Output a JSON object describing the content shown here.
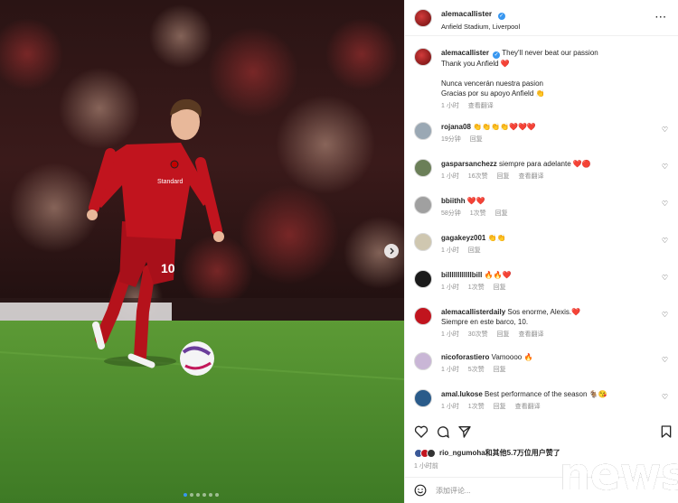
{
  "post": {
    "username": "alemacallister",
    "location": "Anfield Stadium, Liverpool",
    "caption_lines": [
      "They'll never beat our passion",
      "Thank you Anfield ❤️",
      "",
      "Nunca vencerán nuestra pasion",
      "Gracias por su apoyo Anfield 👏"
    ],
    "caption_time": "1 小时",
    "see_translation": "查看翻译",
    "liked_by": "rio_ngumoha和其他5.7万位用户赞了",
    "posted_ago": "1 小时前",
    "add_comment_placeholder": "添加评论..."
  },
  "comments": [
    {
      "user": "rojana08",
      "text": "👏👏👏👏❤️❤️❤️",
      "time": "19分钟",
      "likes": "",
      "reply": "回复",
      "translate": ""
    },
    {
      "user": "gasparsanchezz",
      "text": "siempre para adelante ❤️🔴",
      "time": "1 小时",
      "likes": "16次赞",
      "reply": "回复",
      "translate": "查看翻译"
    },
    {
      "user": "bbiithh",
      "text": "❤️❤️",
      "time": "58分钟",
      "likes": "1次赞",
      "reply": "回复",
      "translate": ""
    },
    {
      "user": "gagakeyz001",
      "text": "👏👏",
      "time": "1 小时",
      "likes": "",
      "reply": "回复",
      "translate": ""
    },
    {
      "user": "billllllllllllbill",
      "text": "🔥🔥❤️",
      "time": "1 小时",
      "likes": "1次赞",
      "reply": "回复",
      "translate": ""
    },
    {
      "user": "alemacallisterdaily",
      "text": "Sos enorme, Alexis.❤️",
      "text2": "Siempre en este barco, 10.",
      "time": "1 小时",
      "likes": "30次赞",
      "reply": "回复",
      "translate": "查看翻译"
    },
    {
      "user": "nicoforastiero",
      "text": "Vamoooo 🔥",
      "time": "1 小时",
      "likes": "5次赞",
      "reply": "回复",
      "translate": ""
    },
    {
      "user": "amal.lukose",
      "text": "Best performance of the season 🐐😘",
      "time": "1 小时",
      "likes": "1次赞",
      "reply": "回复",
      "translate": "查看翻译"
    }
  ],
  "watermark": "news",
  "icons": {
    "more": "more-options-icon",
    "like": "heart-icon",
    "comment": "comment-icon",
    "share": "share-icon",
    "save": "bookmark-icon",
    "emoji": "emoji-icon",
    "next": "chevron-right-icon"
  },
  "colors": {
    "accent": "#3897f0",
    "heart": "#e0245e",
    "kit_red": "#b5121b",
    "pitch": "#4a8a2a"
  },
  "carousel": {
    "slides": 6,
    "active": 1
  }
}
